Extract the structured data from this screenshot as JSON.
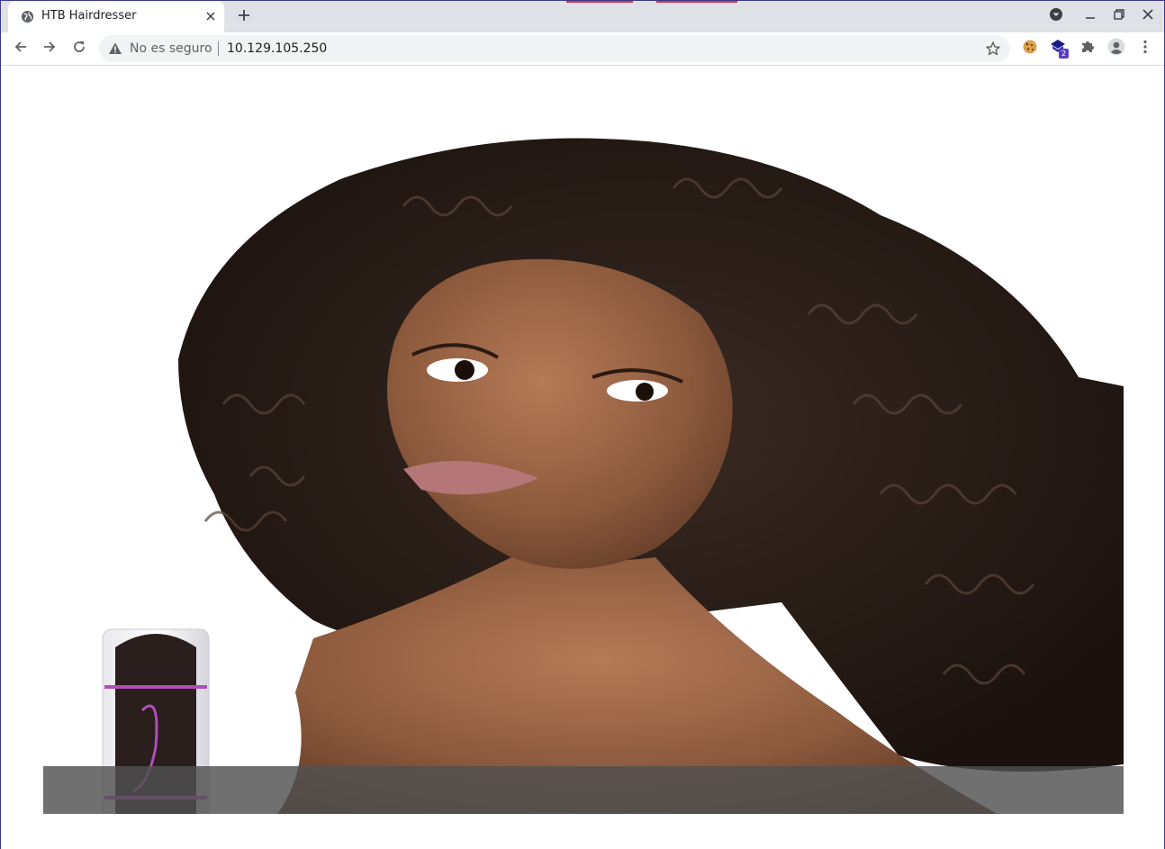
{
  "browser": {
    "tab_title": "HTB Hairdresser",
    "security_label": "No es seguro",
    "url": "10.129.105.250",
    "extension_badge": "2"
  },
  "icons": {
    "tab_favicon": "globe-icon",
    "tab_close": "close-icon",
    "new_tab": "plus-icon",
    "back": "arrow-left-icon",
    "forward": "arrow-right-icon",
    "reload": "reload-icon",
    "security": "warning-icon",
    "bookmark": "star-icon",
    "cookie_extension": "cookie-icon",
    "badge_extension": "extension-badge-icon",
    "extensions": "puzzle-icon",
    "profile": "profile-icon",
    "menu": "kebab-menu-icon",
    "tab_search": "tab-search-icon",
    "minimize": "minimize-icon",
    "restore": "restore-icon",
    "close_window": "close-window-icon"
  },
  "colors": {
    "tabstrip": "#dee1e6",
    "omnibox": "#f1f3f4",
    "caption_bar": "#505050",
    "hair": "#2a1d17",
    "skin": "#9a6444",
    "product_accent": "#b04fb8"
  },
  "page": {
    "hero_image": "portrait-curly-hair-with-product-tube",
    "hero_caption": ""
  }
}
